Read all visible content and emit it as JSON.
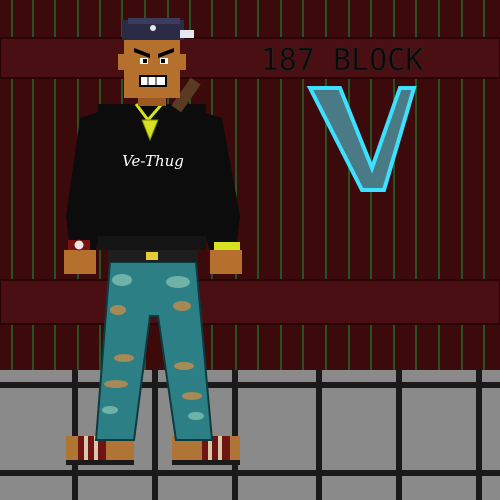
{
  "scene": {
    "sign_text": "187 BLOCK",
    "graffiti_letter": "V",
    "shirt_logo": "Ve-Thug"
  },
  "colors": {
    "wall": "#3d0a0c",
    "wall_plank_line": "#1f6b2f",
    "wall_band": "#4a0f12",
    "pavement": "#8a8a8a",
    "pavement_grout": "#1a1a1a",
    "skin": "#b5702e",
    "shirt": "#0c0c0c",
    "jeans": "#2d7f86",
    "chain": "#d6e21f",
    "graffiti_fill": "#4a7a86",
    "graffiti_outline": "#3ee0ff"
  }
}
